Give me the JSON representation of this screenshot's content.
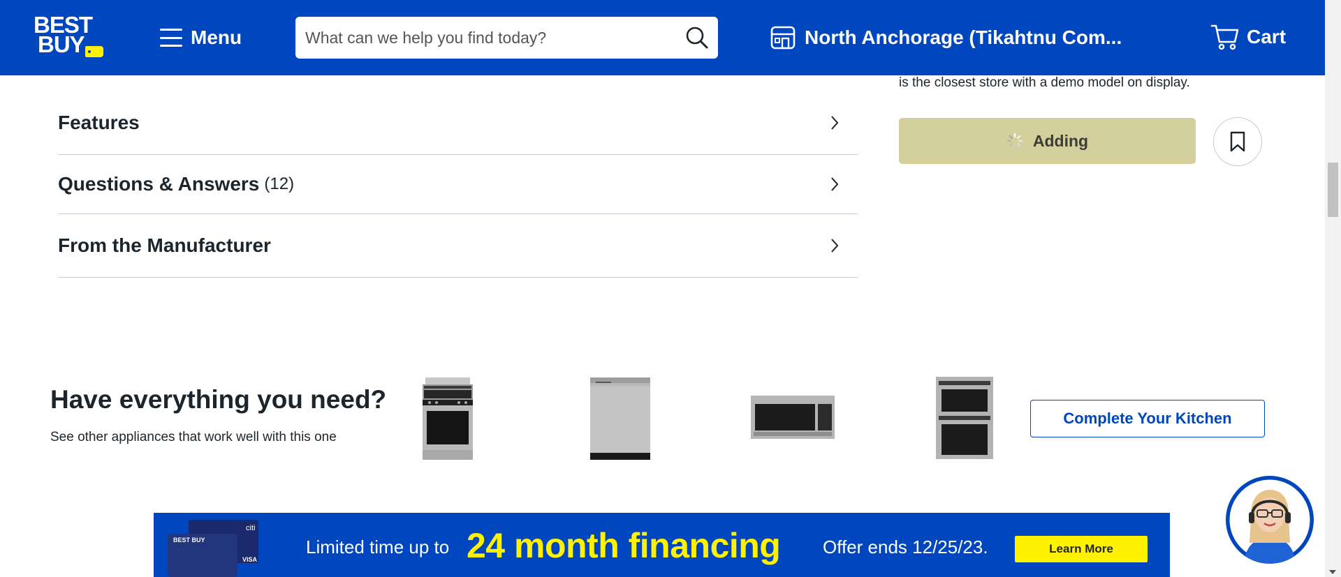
{
  "header": {
    "logo_text_line1": "BEST",
    "logo_text_line2": "BUY",
    "menu_label": "Menu",
    "search_placeholder": "What can we help you find today?",
    "store_label": "North Anchorage (Tikahtnu Com...",
    "cart_label": "Cart",
    "brand_color": "#0046be",
    "tag_color": "#fff200"
  },
  "accordion": {
    "items": [
      {
        "title": "Features",
        "count": ""
      },
      {
        "title": "Questions & Answers",
        "count": "(12)"
      },
      {
        "title": "From the Manufacturer",
        "count": ""
      }
    ]
  },
  "purchase": {
    "demo_note": "is the closest store with a demo model on display.",
    "add_label": "Adding",
    "add_button_color": "#d3d09b"
  },
  "complete_kitchen": {
    "title": "Have everything you need?",
    "subtitle": "See other appliances that work well with this one",
    "appliances": [
      "gas-range",
      "dishwasher",
      "over-range-microwave",
      "wall-oven-combo"
    ],
    "button_label": "Complete Your Kitchen"
  },
  "banner": {
    "pre_text": "Limited time up to",
    "main_text": "24 month financing",
    "offer_text": "Offer ends 12/25/23.",
    "button_label": "Learn More",
    "card_logo_text": "BEST BUY",
    "card_brand_text": "citi",
    "card_network_text": "VISA"
  }
}
